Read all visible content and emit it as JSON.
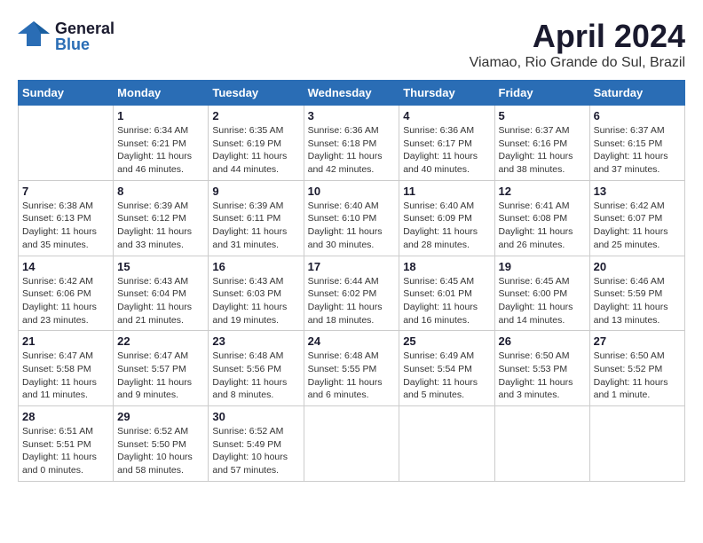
{
  "header": {
    "logo_general": "General",
    "logo_blue": "Blue",
    "month_title": "April 2024",
    "location": "Viamao, Rio Grande do Sul, Brazil"
  },
  "calendar": {
    "days_of_week": [
      "Sunday",
      "Monday",
      "Tuesday",
      "Wednesday",
      "Thursday",
      "Friday",
      "Saturday"
    ],
    "weeks": [
      [
        {
          "day": "",
          "info": ""
        },
        {
          "day": "1",
          "info": "Sunrise: 6:34 AM\nSunset: 6:21 PM\nDaylight: 11 hours\nand 46 minutes."
        },
        {
          "day": "2",
          "info": "Sunrise: 6:35 AM\nSunset: 6:19 PM\nDaylight: 11 hours\nand 44 minutes."
        },
        {
          "day": "3",
          "info": "Sunrise: 6:36 AM\nSunset: 6:18 PM\nDaylight: 11 hours\nand 42 minutes."
        },
        {
          "day": "4",
          "info": "Sunrise: 6:36 AM\nSunset: 6:17 PM\nDaylight: 11 hours\nand 40 minutes."
        },
        {
          "day": "5",
          "info": "Sunrise: 6:37 AM\nSunset: 6:16 PM\nDaylight: 11 hours\nand 38 minutes."
        },
        {
          "day": "6",
          "info": "Sunrise: 6:37 AM\nSunset: 6:15 PM\nDaylight: 11 hours\nand 37 minutes."
        }
      ],
      [
        {
          "day": "7",
          "info": "Sunrise: 6:38 AM\nSunset: 6:13 PM\nDaylight: 11 hours\nand 35 minutes."
        },
        {
          "day": "8",
          "info": "Sunrise: 6:39 AM\nSunset: 6:12 PM\nDaylight: 11 hours\nand 33 minutes."
        },
        {
          "day": "9",
          "info": "Sunrise: 6:39 AM\nSunset: 6:11 PM\nDaylight: 11 hours\nand 31 minutes."
        },
        {
          "day": "10",
          "info": "Sunrise: 6:40 AM\nSunset: 6:10 PM\nDaylight: 11 hours\nand 30 minutes."
        },
        {
          "day": "11",
          "info": "Sunrise: 6:40 AM\nSunset: 6:09 PM\nDaylight: 11 hours\nand 28 minutes."
        },
        {
          "day": "12",
          "info": "Sunrise: 6:41 AM\nSunset: 6:08 PM\nDaylight: 11 hours\nand 26 minutes."
        },
        {
          "day": "13",
          "info": "Sunrise: 6:42 AM\nSunset: 6:07 PM\nDaylight: 11 hours\nand 25 minutes."
        }
      ],
      [
        {
          "day": "14",
          "info": "Sunrise: 6:42 AM\nSunset: 6:06 PM\nDaylight: 11 hours\nand 23 minutes."
        },
        {
          "day": "15",
          "info": "Sunrise: 6:43 AM\nSunset: 6:04 PM\nDaylight: 11 hours\nand 21 minutes."
        },
        {
          "day": "16",
          "info": "Sunrise: 6:43 AM\nSunset: 6:03 PM\nDaylight: 11 hours\nand 19 minutes."
        },
        {
          "day": "17",
          "info": "Sunrise: 6:44 AM\nSunset: 6:02 PM\nDaylight: 11 hours\nand 18 minutes."
        },
        {
          "day": "18",
          "info": "Sunrise: 6:45 AM\nSunset: 6:01 PM\nDaylight: 11 hours\nand 16 minutes."
        },
        {
          "day": "19",
          "info": "Sunrise: 6:45 AM\nSunset: 6:00 PM\nDaylight: 11 hours\nand 14 minutes."
        },
        {
          "day": "20",
          "info": "Sunrise: 6:46 AM\nSunset: 5:59 PM\nDaylight: 11 hours\nand 13 minutes."
        }
      ],
      [
        {
          "day": "21",
          "info": "Sunrise: 6:47 AM\nSunset: 5:58 PM\nDaylight: 11 hours\nand 11 minutes."
        },
        {
          "day": "22",
          "info": "Sunrise: 6:47 AM\nSunset: 5:57 PM\nDaylight: 11 hours\nand 9 minutes."
        },
        {
          "day": "23",
          "info": "Sunrise: 6:48 AM\nSunset: 5:56 PM\nDaylight: 11 hours\nand 8 minutes."
        },
        {
          "day": "24",
          "info": "Sunrise: 6:48 AM\nSunset: 5:55 PM\nDaylight: 11 hours\nand 6 minutes."
        },
        {
          "day": "25",
          "info": "Sunrise: 6:49 AM\nSunset: 5:54 PM\nDaylight: 11 hours\nand 5 minutes."
        },
        {
          "day": "26",
          "info": "Sunrise: 6:50 AM\nSunset: 5:53 PM\nDaylight: 11 hours\nand 3 minutes."
        },
        {
          "day": "27",
          "info": "Sunrise: 6:50 AM\nSunset: 5:52 PM\nDaylight: 11 hours\nand 1 minute."
        }
      ],
      [
        {
          "day": "28",
          "info": "Sunrise: 6:51 AM\nSunset: 5:51 PM\nDaylight: 11 hours\nand 0 minutes."
        },
        {
          "day": "29",
          "info": "Sunrise: 6:52 AM\nSunset: 5:50 PM\nDaylight: 10 hours\nand 58 minutes."
        },
        {
          "day": "30",
          "info": "Sunrise: 6:52 AM\nSunset: 5:49 PM\nDaylight: 10 hours\nand 57 minutes."
        },
        {
          "day": "",
          "info": ""
        },
        {
          "day": "",
          "info": ""
        },
        {
          "day": "",
          "info": ""
        },
        {
          "day": "",
          "info": ""
        }
      ]
    ]
  }
}
